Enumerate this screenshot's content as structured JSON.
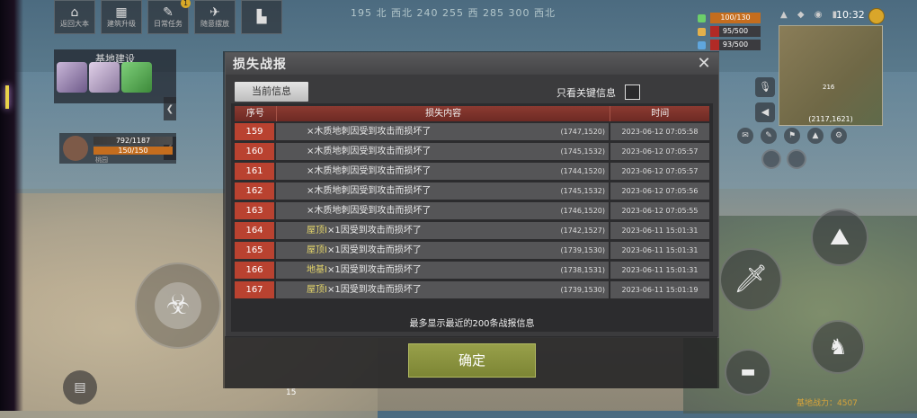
{
  "top_bar": {
    "buttons": [
      {
        "icon": "home-icon",
        "label": "返回大本"
      },
      {
        "icon": "building-icon",
        "label": "建筑升级"
      },
      {
        "icon": "scroll-icon",
        "label": "日常任务",
        "badge": "1"
      },
      {
        "icon": "plane-icon",
        "label": "随意摆放"
      },
      {
        "icon": "chart-icon",
        "label": ""
      }
    ],
    "compass": "195   北   西北   240   255   西   285   300   西北"
  },
  "left_hud": {
    "base_title": "基地建设",
    "hp_text": "792/1187",
    "energy_text": "150/150",
    "player_name": "桃园"
  },
  "right_hud": {
    "stats": [
      {
        "icon": "heart-icon",
        "value": "100/130",
        "color": "#c46d1e"
      },
      {
        "icon": "food-icon",
        "value": "95/500",
        "color": "#b12a26"
      },
      {
        "icon": "water-icon",
        "value": "93/500",
        "color": "#b12a26"
      }
    ],
    "clock": "10:32",
    "minimap_coords": "(2117,1621)",
    "minimap_level": "216",
    "power_label": "基地战力：4507"
  },
  "dialog": {
    "title": "损失战报",
    "tab_current": "当前信息",
    "key_only_label": "只看关键信息",
    "columns": [
      "序号",
      "损失内容",
      "时间"
    ],
    "rows": [
      {
        "id": "159",
        "highlight": "",
        "text": "×木质地刺因受到攻击而损坏了",
        "pos": "(1747,1520)",
        "time": "2023-06-12 07:05:58"
      },
      {
        "id": "160",
        "highlight": "",
        "text": "×木质地刺因受到攻击而损坏了",
        "pos": "(1745,1532)",
        "time": "2023-06-12 07:05:57"
      },
      {
        "id": "161",
        "highlight": "",
        "text": "×木质地刺因受到攻击而损坏了",
        "pos": "(1744,1520)",
        "time": "2023-06-12 07:05:57"
      },
      {
        "id": "162",
        "highlight": "",
        "text": "×木质地刺因受到攻击而损坏了",
        "pos": "(1745,1532)",
        "time": "2023-06-12 07:05:56"
      },
      {
        "id": "163",
        "highlight": "",
        "text": "×木质地刺因受到攻击而损坏了",
        "pos": "(1746,1520)",
        "time": "2023-06-12 07:05:55"
      },
      {
        "id": "164",
        "highlight": "屋顶I",
        "text": "×1因受到攻击而损坏了",
        "pos": "(1742,1527)",
        "time": "2023-06-11 15:01:31"
      },
      {
        "id": "165",
        "highlight": "屋顶I",
        "text": "×1因受到攻击而损坏了",
        "pos": "(1739,1530)",
        "time": "2023-06-11 15:01:31"
      },
      {
        "id": "166",
        "highlight": "地基I",
        "text": "×1因受到攻击而损坏了",
        "pos": "(1738,1531)",
        "time": "2023-06-11 15:01:31"
      },
      {
        "id": "167",
        "highlight": "屋顶I",
        "text": "×1因受到攻击而损坏了",
        "pos": "(1739,1530)",
        "time": "2023-06-11 15:01:19"
      }
    ],
    "footer_note": "最多显示最近的200条战报信息",
    "confirm_label": "确定"
  },
  "bottom": {
    "level_marker": "15"
  }
}
